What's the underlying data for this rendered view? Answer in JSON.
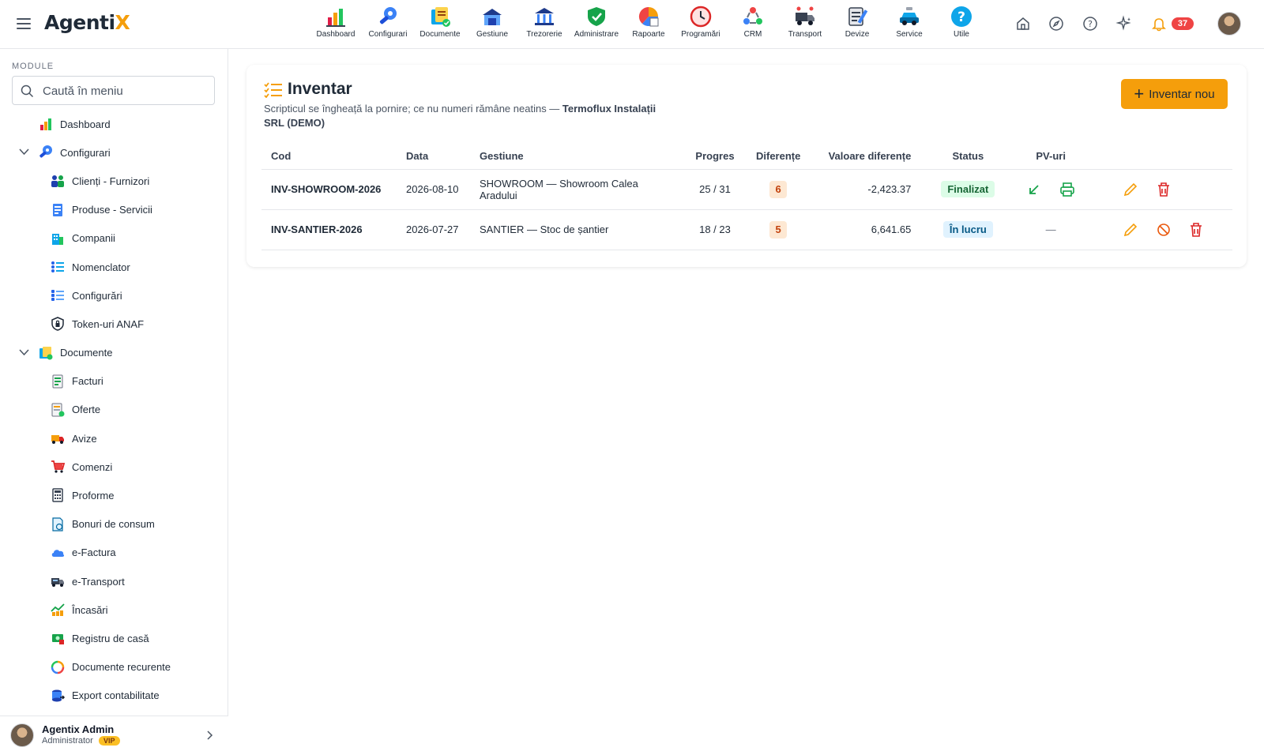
{
  "app": {
    "logo_main": "Agenti",
    "logo_accent": "X"
  },
  "top_modules": [
    {
      "label": "Dashboard",
      "icon": "dashboard-icon"
    },
    {
      "label": "Configurari",
      "icon": "wrench-icon"
    },
    {
      "label": "Documente",
      "icon": "documents-icon"
    },
    {
      "label": "Gestiune",
      "icon": "warehouse-icon"
    },
    {
      "label": "Trezorerie",
      "icon": "bank-icon"
    },
    {
      "label": "Administrare",
      "icon": "shield-icon"
    },
    {
      "label": "Rapoarte",
      "icon": "report-icon"
    },
    {
      "label": "Programări",
      "icon": "clock-icon"
    },
    {
      "label": "CRM",
      "icon": "crm-icon"
    },
    {
      "label": "Transport",
      "icon": "truck-icon"
    },
    {
      "label": "Devize",
      "icon": "estimate-icon"
    },
    {
      "label": "Service",
      "icon": "car-icon"
    },
    {
      "label": "Utile",
      "icon": "help-icon"
    }
  ],
  "header_right": {
    "icons": [
      "home-icon",
      "compass-icon",
      "help-circle-icon",
      "sparkle-icon",
      "bell-icon"
    ],
    "notifications_count": "37"
  },
  "sidebar": {
    "heading": "MODULE",
    "search_placeholder": "Caută în meniu",
    "items": [
      {
        "label": "Dashboard",
        "level": 0,
        "icon": "dashboard-icon"
      },
      {
        "label": "Configurari",
        "level": 0,
        "icon": "wrench-icon",
        "expanded": true
      },
      {
        "label": "Clienți - Furnizori",
        "level": 1,
        "icon": "people-icon"
      },
      {
        "label": "Produse - Servicii",
        "level": 1,
        "icon": "product-icon"
      },
      {
        "label": "Companii",
        "level": 1,
        "icon": "building-icon"
      },
      {
        "label": "Nomenclator",
        "level": 1,
        "icon": "list-icon"
      },
      {
        "label": "Configurări",
        "level": 1,
        "icon": "settings-list-icon"
      },
      {
        "label": "Token-uri ANAF",
        "level": 1,
        "icon": "lock-shield-icon"
      },
      {
        "label": "Documente",
        "level": 0,
        "icon": "documents-icon",
        "expanded": true
      },
      {
        "label": "Facturi",
        "level": 1,
        "icon": "invoice-icon"
      },
      {
        "label": "Oferte",
        "level": 1,
        "icon": "offer-icon"
      },
      {
        "label": "Avize",
        "level": 1,
        "icon": "delivery-truck-icon"
      },
      {
        "label": "Comenzi",
        "level": 1,
        "icon": "cart-icon"
      },
      {
        "label": "Proforme",
        "level": 1,
        "icon": "calculator-icon"
      },
      {
        "label": "Bonuri de consum",
        "level": 1,
        "icon": "receipt-icon"
      },
      {
        "label": "e-Factura",
        "level": 1,
        "icon": "cloud-icon"
      },
      {
        "label": "e-Transport",
        "level": 1,
        "icon": "truck-icon"
      },
      {
        "label": "Încasări",
        "level": 1,
        "icon": "chart-coins-icon"
      },
      {
        "label": "Registru de casă",
        "level": 1,
        "icon": "cash-register-icon"
      },
      {
        "label": "Documente recurente",
        "level": 1,
        "icon": "recurring-icon"
      },
      {
        "label": "Export contabilitate",
        "level": 1,
        "icon": "database-export-icon"
      }
    ],
    "user": {
      "name": "Agentix Admin",
      "role": "Administrator",
      "badge": "VIP"
    }
  },
  "page": {
    "title": "Inventar",
    "subtitle": "Scripticul se îngheață la pornire; ce nu numeri rămâne neatins — ",
    "company": "Termoflux Instalații SRL (DEMO)",
    "new_button": "Inventar nou"
  },
  "table": {
    "columns": [
      "Cod",
      "Data",
      "Gestiune",
      "Progres",
      "Diferențe",
      "Valoare diferențe",
      "Status",
      "PV-uri"
    ],
    "rows": [
      {
        "code": "INV-SHOWROOM-2026",
        "date": "2026-08-10",
        "warehouse": "SHOWROOM — Showroom Calea Aradului",
        "progress": "25 / 31",
        "differences": "6",
        "value": "-2,423.37",
        "value_sign": "negative",
        "status": "Finalizat",
        "pv": [
          "export-icon",
          "print-icon"
        ],
        "actions": [
          "edit-icon",
          "delete-icon"
        ]
      },
      {
        "code": "INV-SANTIER-2026",
        "date": "2026-07-27",
        "warehouse": "SANTIER — Stoc de șantier",
        "progress": "18 / 23",
        "differences": "5",
        "value": "6,641.65",
        "value_sign": "positive",
        "status": "În lucru",
        "pv_text": "—",
        "actions": [
          "edit-icon",
          "cancel-icon",
          "delete-icon"
        ]
      }
    ]
  },
  "colors": {
    "accent": "#f59e0b",
    "negative": "#dc2626",
    "positive": "#16a34a",
    "status_done_bg": "#dcfce7",
    "status_work_bg": "#e0f2fe",
    "badge_red": "#ef4444"
  }
}
